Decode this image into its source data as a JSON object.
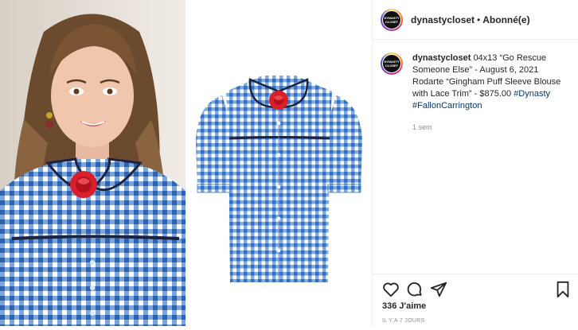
{
  "post": {
    "username": "dynastycloset",
    "avatar_text": "DYNASTY CLOSET",
    "separator": "•",
    "follow_status": "Abonné(e)"
  },
  "caption": {
    "username": "dynastycloset",
    "text": "04x13 “Go Rescue Someone Else” - August 6, 2021 Rodarte “Gingham Puff Sleeve Blouse with Lace Trim” - $875.00",
    "hashtag_1": "#Dynasty",
    "hashtag_2": "#FallonCarrington",
    "time": "1 sem"
  },
  "footer": {
    "likes": "336 J'aime",
    "posted_ago": "IL Y A 7 JOURS"
  },
  "icons": {
    "like": "heart-icon",
    "comment": "comment-icon",
    "share": "share-icon",
    "save": "bookmark-icon"
  },
  "colors": {
    "gingham_blue": "#3f7fcf",
    "hashtag": "#00376b",
    "muted": "#8e8e8e"
  }
}
